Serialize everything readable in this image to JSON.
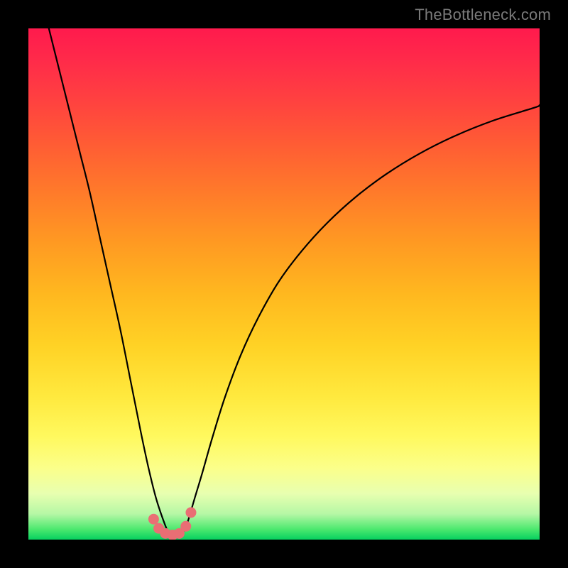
{
  "watermark": "TheBottleneck.com",
  "colors": {
    "page_bg": "#000000",
    "curve": "#000000",
    "dots": "#e96e74",
    "gradient_top": "#ff1a4d",
    "gradient_bottom": "#07d060"
  },
  "chart_data": {
    "type": "line",
    "title": "",
    "xlabel": "",
    "ylabel": "",
    "xlim": [
      0,
      100
    ],
    "ylim": [
      0,
      100
    ],
    "grid": false,
    "legend": false,
    "series": [
      {
        "name": "left-branch",
        "x": [
          4,
          6,
          8,
          10,
          12,
          14,
          16,
          18,
          20,
          22,
          23.5,
          25,
          26.5,
          27.5
        ],
        "y": [
          100,
          92,
          84,
          76,
          68,
          59,
          50,
          41,
          31,
          21,
          14,
          8,
          3.5,
          1
        ]
      },
      {
        "name": "right-branch",
        "x": [
          30,
          31,
          32.5,
          34,
          36,
          38.5,
          41.5,
          45,
          49,
          53.5,
          58.5,
          64,
          70,
          76.5,
          83.5,
          91,
          99,
          100
        ],
        "y": [
          1,
          3,
          8,
          13,
          20,
          28,
          36,
          43.5,
          50.5,
          56.5,
          62,
          67,
          71.5,
          75.5,
          79,
          82,
          84.5,
          85
        ]
      }
    ],
    "markers": [
      {
        "x": 24.5,
        "y": 4.0
      },
      {
        "x": 25.5,
        "y": 2.2
      },
      {
        "x": 26.8,
        "y": 1.2
      },
      {
        "x": 28.2,
        "y": 0.9
      },
      {
        "x": 29.5,
        "y": 1.2
      },
      {
        "x": 30.8,
        "y": 2.6
      },
      {
        "x": 31.8,
        "y": 5.3
      }
    ],
    "yellow_band": {
      "y0": 20,
      "y1": 80
    }
  }
}
